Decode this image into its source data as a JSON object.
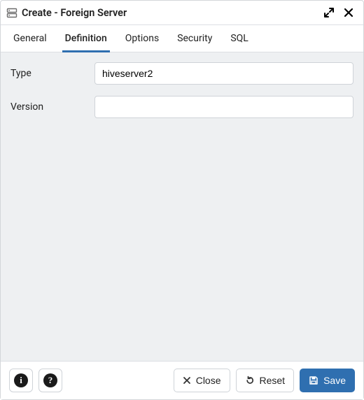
{
  "header": {
    "title": "Create - Foreign Server"
  },
  "tabs": [
    {
      "label": "General",
      "active": false
    },
    {
      "label": "Definition",
      "active": true
    },
    {
      "label": "Options",
      "active": false
    },
    {
      "label": "Security",
      "active": false
    },
    {
      "label": "SQL",
      "active": false
    }
  ],
  "form": {
    "type": {
      "label": "Type",
      "value": "hiveserver2"
    },
    "version": {
      "label": "Version",
      "value": ""
    }
  },
  "footer": {
    "close_label": "Close",
    "reset_label": "Reset",
    "save_label": "Save"
  },
  "icons": {
    "info_glyph": "i",
    "help_glyph": "?"
  }
}
